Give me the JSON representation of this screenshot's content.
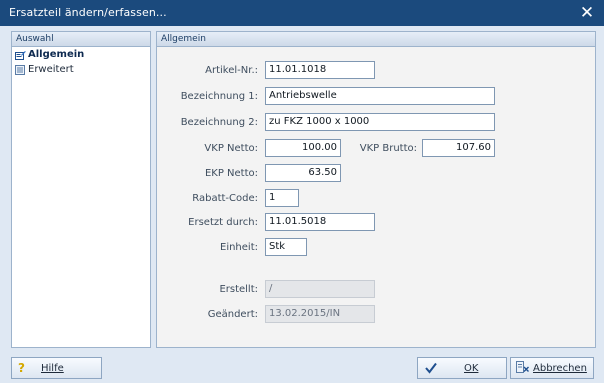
{
  "window": {
    "title": "Ersatzteil ändern/erfassen...",
    "close_glyph": "✕"
  },
  "sidebar": {
    "header": "Auswahl",
    "items": [
      {
        "label": "Allgemein",
        "icon": "form-edit-icon",
        "active": true
      },
      {
        "label": "Erweitert",
        "icon": "document-list-icon",
        "active": false
      }
    ]
  },
  "main": {
    "header": "Allgemein",
    "fields": {
      "artikel_nr": {
        "label": "Artikel-Nr.:",
        "value": "11.01.1018"
      },
      "bezeichnung1": {
        "label": "Bezeichnung 1:",
        "value": "Antriebswelle"
      },
      "bezeichnung2": {
        "label": "Bezeichnung 2:",
        "value": "zu FKZ 1000 x 1000"
      },
      "vkp_netto": {
        "label": "VKP Netto:",
        "value": "100.00"
      },
      "vkp_brutto": {
        "label": "VKP Brutto:",
        "value": "107.60"
      },
      "ekp_netto": {
        "label": "EKP Netto:",
        "value": "63.50"
      },
      "rabatt_code": {
        "label": "Rabatt-Code:",
        "value": "1"
      },
      "ersetzt_durch": {
        "label": "Ersetzt durch:",
        "value": "11.01.5018"
      },
      "einheit": {
        "label": "Einheit:",
        "value": "Stk"
      },
      "erstellt": {
        "label": "Erstellt:",
        "value": "/"
      },
      "geaendert": {
        "label": "Geändert:",
        "value": "13.02.2015/IN"
      }
    }
  },
  "buttons": {
    "help": {
      "label": "Hilfe",
      "icon": "question-icon"
    },
    "ok": {
      "label": "OK",
      "icon": "checkmark-icon"
    },
    "cancel": {
      "label": "Abbrechen",
      "icon": "cancel-list-icon"
    }
  },
  "colors": {
    "titlebar": "#1b4a7d",
    "frame": "#dfe8f3",
    "pane_header": "#cdd9e8",
    "field_border": "#7f97b2",
    "readonly_field": "#e4e6e9"
  }
}
